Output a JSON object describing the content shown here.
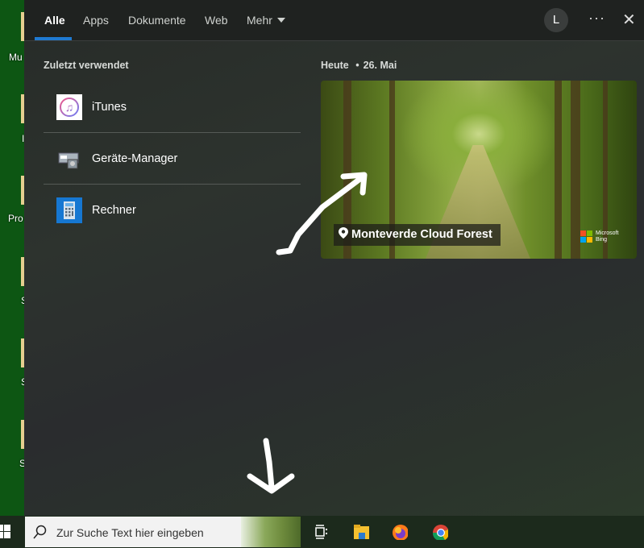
{
  "desktop": {
    "labels": [
      "Mu",
      "I",
      "Pro",
      "S",
      "S",
      "S"
    ]
  },
  "nav": {
    "tabs": [
      "Alle",
      "Apps",
      "Dokumente",
      "Web",
      "Mehr"
    ],
    "avatar": "L",
    "more": "···",
    "close": "✕"
  },
  "recent": {
    "heading": "Zuletzt verwendet",
    "items": [
      {
        "label": "iTunes"
      },
      {
        "label": "Geräte-Manager"
      },
      {
        "label": "Rechner"
      }
    ]
  },
  "today": {
    "heading": "Heute",
    "separator": "•",
    "date": "26. Mai",
    "location": "Monteverde Cloud Forest",
    "brand_line1": "Microsoft",
    "brand_line2": "Bing"
  },
  "taskbar": {
    "search_placeholder": "Zur Suche Text hier eingeben"
  },
  "colors": {
    "accent": "#1f7ad1",
    "desktop": "#0d5613"
  }
}
